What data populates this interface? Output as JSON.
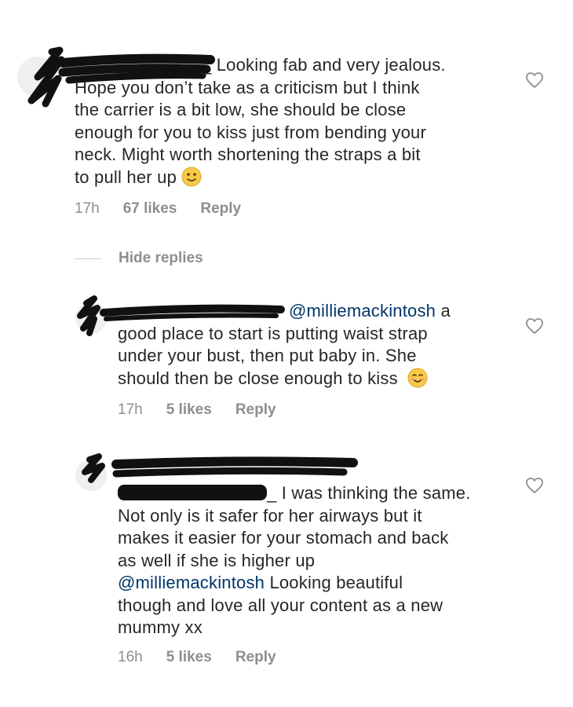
{
  "comments": [
    {
      "username_visible": "_",
      "text": "Looking fab and very jealous. Hope you don’t take as a criticism but I think the carrier is a bit low, she should be close enough for you to kiss just from bending your neck. Might worth shortening the straps a bit to pull her up",
      "lines": [
        "Looking fab and very jealous.",
        "Hope you don’t take as a criticism but I think",
        "the carrier is a bit low, she should be close",
        "enough for you to kiss just from bending your",
        "neck. Might worth shortening the straps a bit",
        "to pull her up"
      ],
      "emoji": "slightly-smiling-face",
      "time": "17h",
      "likes": "67 likes",
      "reply": "Reply"
    },
    {
      "mention": "@milliemackintosh",
      "lines": [
        "a",
        "good place to start is putting waist strap",
        "under your bust,  then put baby in. She",
        "should then be close enough to kiss"
      ],
      "emoji": "smiling-face",
      "time": "17h",
      "likes": "5 likes",
      "reply": "Reply"
    },
    {
      "username_visible": "_",
      "lines": [
        "I was thinking the same.",
        "Not only is it safer for her airways but it",
        "makes it easier for your stomach and back",
        "as well if she is higher up"
      ],
      "mention": "@milliemackintosh",
      "lines_after_mention": [
        "Looking beautiful",
        "though and love all your content as a new",
        "mummy xx"
      ],
      "time": "16h",
      "likes": "5 likes",
      "reply": "Reply"
    }
  ],
  "hide_replies": "Hide replies",
  "colors": {
    "text": "#262626",
    "meta": "#8e8e8e",
    "mention": "#003569",
    "redaction": "#111111"
  }
}
